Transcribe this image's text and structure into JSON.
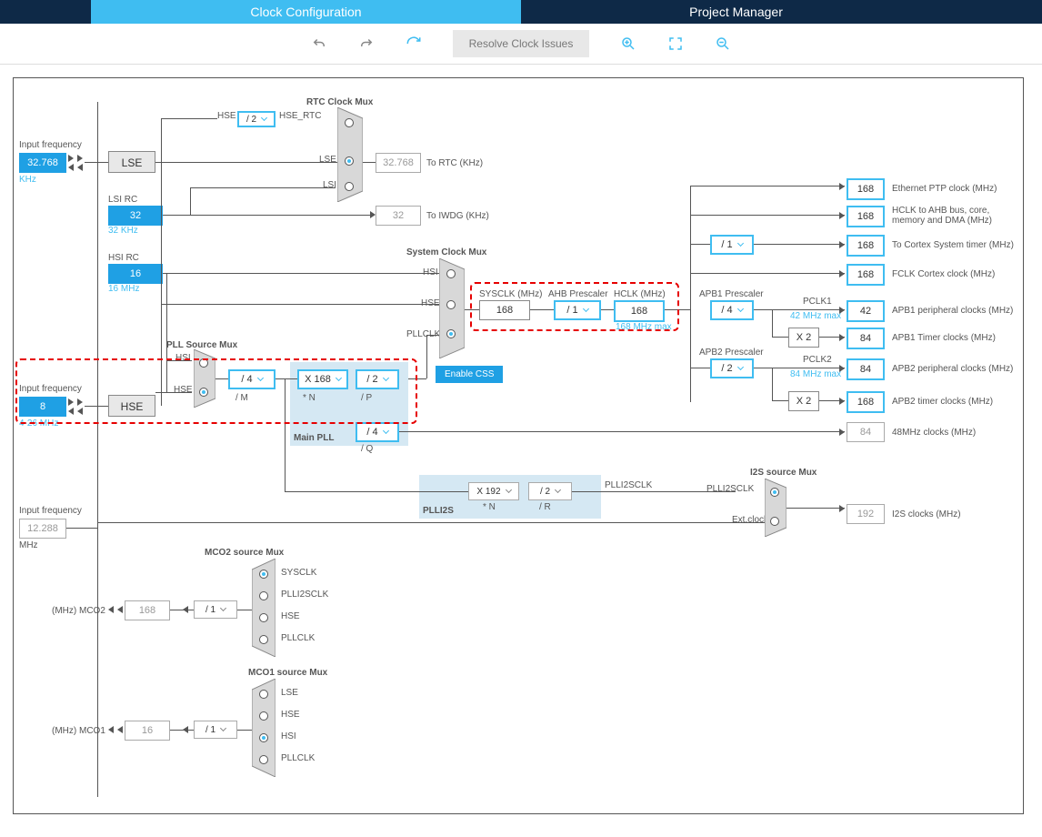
{
  "tabs": {
    "active": "Clock Configuration",
    "inactive": "Project Manager"
  },
  "toolbar": {
    "resolve": "Resolve Clock Issues"
  },
  "inputs": {
    "lse_freq_label": "Input frequency",
    "lse_freq": "32.768",
    "lse_unit": "KHz",
    "lse_name": "LSE",
    "lsi_label": "LSI RC",
    "lsi_val": "32",
    "lsi_unit": "32 KHz",
    "hsi_label": "HSI RC",
    "hsi_val": "16",
    "hsi_unit": "16 MHz",
    "hse_freq_label": "Input frequency",
    "hse_freq": "8",
    "hse_unit": "4-26 MHz",
    "hse_name": "HSE",
    "i2s_freq_label": "Input frequency",
    "i2s_freq": "12.288",
    "i2s_unit": "MHz"
  },
  "rtc_mux": {
    "title": "RTC Clock Mux",
    "hse_div": "/ 2",
    "hse_label": "HSE",
    "hse_rtc": "HSE_RTC",
    "lse_label": "LSE",
    "lsi_label": "LSI",
    "rtc_out": "32.768",
    "rtc_out_label": "To RTC (KHz)",
    "iwdg_out": "32",
    "iwdg_out_label": "To IWDG (KHz)"
  },
  "pll_src": {
    "title": "PLL Source Mux",
    "hsi": "HSI",
    "hse": "HSE"
  },
  "main_pll": {
    "title": "Main PLL",
    "m": "/ 4",
    "m_label": "/ M",
    "n": "X 168",
    "n_label": "* N",
    "p": "/ 2",
    "p_label": "/ P",
    "q": "/ 4",
    "q_label": "/ Q"
  },
  "plli2s": {
    "title": "PLLI2S",
    "n": "X 192",
    "n_label": "* N",
    "r": "/ 2",
    "r_label": "/ R"
  },
  "sysclk_mux": {
    "title": "System Clock Mux",
    "hsi": "HSI",
    "hse": "HSE",
    "pllclk": "PLLCLK",
    "css": "Enable CSS",
    "sysclk_label": "SYSCLK (MHz)",
    "sysclk": "168",
    "ahb_label": "AHB Prescaler",
    "ahb": "/ 1",
    "hclk_label": "HCLK (MHz)",
    "hclk": "168",
    "hclk_max": "168 MHz max"
  },
  "outputs": {
    "eth": {
      "val": "168",
      "label": "Ethernet PTP clock (MHz)"
    },
    "hclk_bus": {
      "val": "168",
      "label": "HCLK to AHB bus, core, memory and DMA (MHz)"
    },
    "cortex_div": "/ 1",
    "cortex": {
      "val": "168",
      "label": "To Cortex System timer (MHz)"
    },
    "fclk": {
      "val": "168",
      "label": "FCLK Cortex clock (MHz)"
    },
    "apb1_label": "APB1 Prescaler",
    "apb1_div": "/ 4",
    "pclk1_label": "PCLK1",
    "pclk1_max": "42 MHz max",
    "apb1_periph": {
      "val": "42",
      "label": "APB1 peripheral clocks (MHz)"
    },
    "apb1_timer_mul": "X 2",
    "apb1_timer": {
      "val": "84",
      "label": "APB1 Timer clocks (MHz)"
    },
    "apb2_label": "APB2 Prescaler",
    "apb2_div": "/ 2",
    "pclk2_label": "PCLK2",
    "pclk2_max": "84 MHz max",
    "apb2_periph": {
      "val": "84",
      "label": "APB2 peripheral clocks (MHz)"
    },
    "apb2_timer_mul": "X 2",
    "apb2_timer": {
      "val": "168",
      "label": "APB2 timer clocks (MHz)"
    },
    "clk48": {
      "val": "84",
      "label": "48MHz clocks (MHz)"
    },
    "i2s_mux_label": "I2S source Mux",
    "plli2sclk": "PLLI2SCLK",
    "extclock": "Ext.clock",
    "i2s_out": {
      "val": "192",
      "label": "I2S clocks (MHz)"
    }
  },
  "mco2": {
    "title": "MCO2 source Mux",
    "opts": [
      "SYSCLK",
      "PLLI2SCLK",
      "HSE",
      "PLLCLK"
    ],
    "div": "/ 1",
    "out": "168",
    "out_label": "(MHz) MCO2"
  },
  "mco1": {
    "title": "MCO1 source Mux",
    "opts": [
      "LSE",
      "HSE",
      "HSI",
      "PLLCLK"
    ],
    "div": "/ 1",
    "out": "16",
    "out_label": "(MHz) MCO1"
  }
}
